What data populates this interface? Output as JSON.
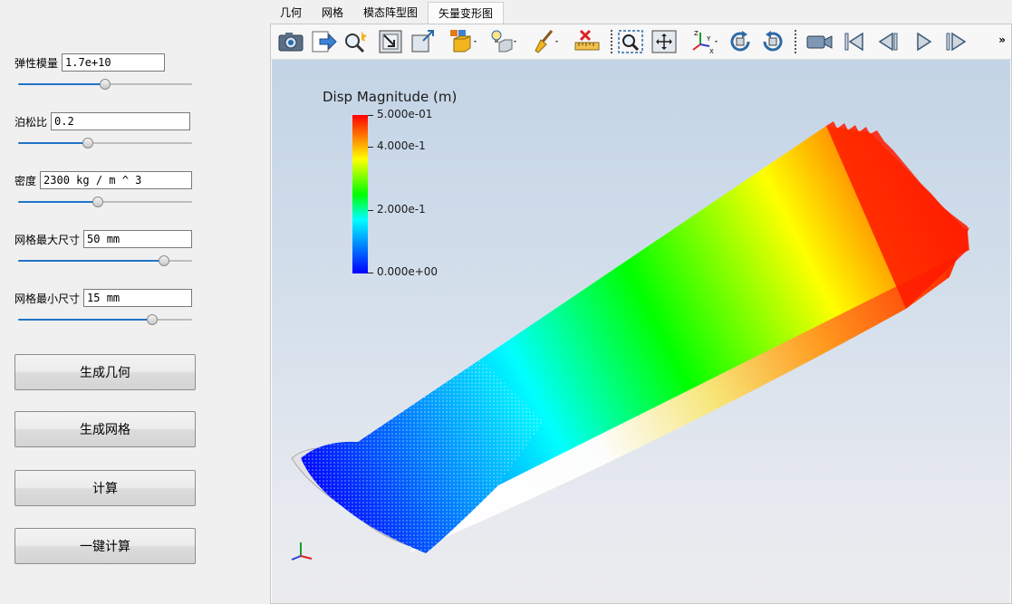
{
  "tabs": [
    {
      "label": "几何",
      "active": false
    },
    {
      "label": "网格",
      "active": false
    },
    {
      "label": "模态阵型图",
      "active": false
    },
    {
      "label": "矢量变形图",
      "active": true
    }
  ],
  "params": [
    {
      "label": "弹性模量",
      "value": "1.7e+10",
      "slider_level": 0.5
    },
    {
      "label": "泊松比",
      "value": "0.2",
      "slider_level": 0.4
    },
    {
      "label": "密度",
      "value": "2300 kg / m ^ 3",
      "slider_level": 0.46
    },
    {
      "label": "网格最大尺寸",
      "value": "50 mm",
      "slider_level": 0.84
    },
    {
      "label": "网格最小尺寸",
      "value": "15 mm",
      "slider_level": 0.77
    }
  ],
  "buttons": {
    "generate_geometry": "生成几何",
    "generate_mesh": "生成网格",
    "compute": "计算",
    "one_click_compute": "一键计算"
  },
  "toolbar": {
    "icons": [
      "camera-icon",
      "export-icon",
      "zoom-magic-icon",
      "reset-view-icon",
      "maximize-icon",
      "box-shading-icon",
      "light-bulb-icon",
      "clear-brush-icon",
      "delete-ruler-icon",
      "zoom-box-icon",
      "fit-view-icon",
      "axes-orientation-icon",
      "rotate-cw-icon",
      "rotate-ccw-icon",
      "record-camera-icon",
      "first-frame-icon",
      "prev-frame-icon",
      "play-icon",
      "last-frame-icon"
    ],
    "more": "»"
  },
  "legend": {
    "title": "Disp Magnitude (m)",
    "ticks": [
      "5.000e-01",
      "4.000e-1",
      "2.000e-1",
      "0.000e+00"
    ],
    "max": 0.5,
    "min": 0.0
  },
  "colors": {
    "accent": "#1f74c9",
    "background_top": "#c3d4e6",
    "background_bottom": "#ececee"
  }
}
